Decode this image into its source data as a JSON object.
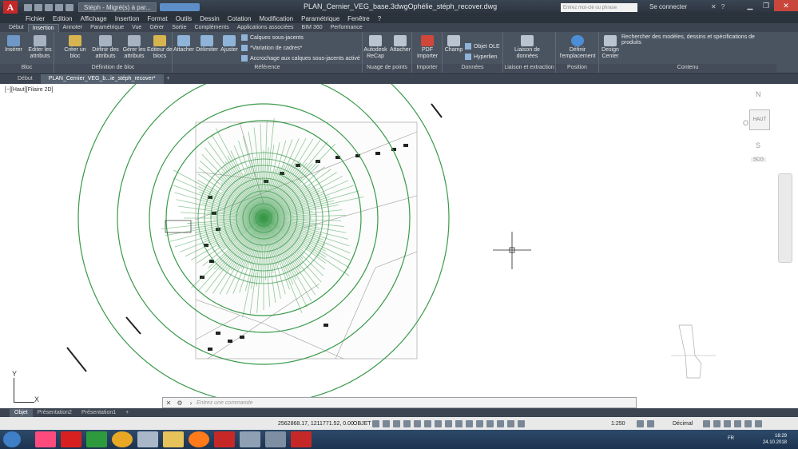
{
  "app": {
    "workspace": "Stéph - Migré(s) à par...",
    "window_title": "PLAN_Cernier_VEG_base.3dwgOphélie_stéph_recover.dwg",
    "search_placeholder": "Entrez mot-clé ou phrase",
    "sign_in": "Se connecter",
    "logo": "A"
  },
  "menus": [
    "Fichier",
    "Edition",
    "Affichage",
    "Insertion",
    "Format",
    "Outils",
    "Dessin",
    "Cotation",
    "Modification",
    "Paramétrique",
    "Fenêtre",
    "?"
  ],
  "ribbon_tabs": [
    "Début",
    "Insertion",
    "Annoter",
    "Paramétrique",
    "Vue",
    "Gérer",
    "Sortie",
    "Compléments",
    "Applications associées",
    "BIM 360",
    "Performance"
  ],
  "ribbon_active_tab": "Insertion",
  "panels": {
    "bloc": {
      "label": "Bloc",
      "tools": [
        "Insérer",
        "Editer les attributs"
      ]
    },
    "definition": {
      "label": "Définition de bloc",
      "tools": [
        "Créer un bloc",
        "Définir des attributs",
        "Gérer les attributs",
        "Editeur de blocs"
      ]
    },
    "reference": {
      "label": "Référence",
      "tools": [
        "Attacher",
        "Délimiter",
        "Ajuster"
      ],
      "options": [
        "Calques sous-jacents",
        "*Variation de cadres*",
        "Accrochage aux calques sous-jacents activé"
      ]
    },
    "nuage": {
      "label": "Nuage de points",
      "tools": [
        "Autodesk ReCap",
        "Attacher"
      ]
    },
    "importer": {
      "label": "Importer",
      "tools": [
        "PDF Importer"
      ]
    },
    "donnees": {
      "label": "Données",
      "tools": [
        "Champ",
        "Objet OLE",
        "Hyperlien"
      ]
    },
    "liaison": {
      "label": "Liaison et extraction",
      "tools": [
        "Liaison de données"
      ]
    },
    "position": {
      "label": "Position",
      "tools": [
        "Définir l'emplacement"
      ]
    },
    "contenu": {
      "label": "Contenu",
      "tools": [
        "Design Center"
      ],
      "text": "Rechercher des modèles, dessins et spécifications de produits"
    }
  },
  "doc_tabs": [
    "Début",
    "PLAN_Cernier_VEG_b...ie_stéph_recover*"
  ],
  "viewport_label": "[−][Haut][Filaire 2D]",
  "viewcube": {
    "top": "HAUT",
    "north": "N",
    "south": "S",
    "west": "O",
    "ucs": "SCG"
  },
  "ucs_icon": {
    "x": "X",
    "y": "Y"
  },
  "command_placeholder": "Entrez une commande",
  "layout_tabs": [
    "Objet",
    "Présentation2",
    "Présentation1"
  ],
  "status": {
    "coords": "2562868.17, 1211771.52, 0.00",
    "mode": "OBJET",
    "scale": "1:250",
    "units": "Décimal"
  },
  "taskbar": {
    "language": "FR",
    "time": "18:29",
    "date": "24.10.2018"
  },
  "colors": {
    "rings": "#3a9a4a",
    "ribbon": "#4a5461",
    "accent": "#c62828"
  }
}
